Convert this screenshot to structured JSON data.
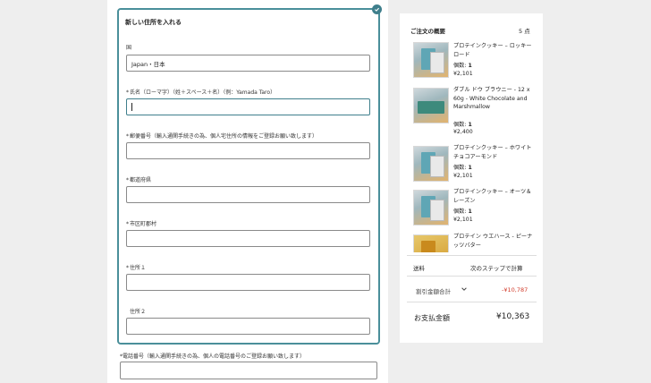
{
  "form": {
    "title": "新しい住所を入れる",
    "country_label": "国",
    "country_value": "Japan・日本",
    "name_label": "氏名（ローマ字）（姓＋スペース＋名）（例：Yamada Taro）",
    "zip_label": "郵便番号（輸入通関手続きの為、個人宅住所の情報をご登録お願い致します）",
    "prefecture_label": "都道府県",
    "city_label": "市区町郡村",
    "address1_label": "住所１",
    "address2_label": "住所２",
    "phone_label": "電話番号（輸入通関手続きの為、個人の電話番号のご登録お願い致します）",
    "required_mark": "*"
  },
  "summary": {
    "title": "ご注文の概要",
    "count": "5 点",
    "items": [
      {
        "name": "プロテインクッキー – ロッキーロード",
        "qty_label": "個数:",
        "qty": "1",
        "price": "¥2,101",
        "image": "protein-cookie-pack"
      },
      {
        "name": "ダブル ドウ ブラウニー - 12 x 60g - White Chocolate and Marshmallow",
        "qty_label": "個数:",
        "qty": "1",
        "price": "¥2,400",
        "image": "brownie-box"
      },
      {
        "name": "プロテインクッキー – ホワイトチョコアーモンド",
        "qty_label": "個数:",
        "qty": "1",
        "price": "¥2,101",
        "image": "protein-cookie-pack"
      },
      {
        "name": "プロテインクッキー – オーツ＆レーズン",
        "qty_label": "個数:",
        "qty": "1",
        "price": "¥2,101",
        "image": "protein-cookie-pack"
      },
      {
        "name": "プロテイン ウエハース - ピーナッツバター",
        "image": "wafer-box"
      }
    ],
    "shipping_label": "送料",
    "shipping_value": "次のステップで計算",
    "discount_label": "割引金額合計",
    "discount_value": "-¥10,787",
    "total_label": "お支払金額",
    "total_value": "¥10,363",
    "accent_color": "#3f7f8c",
    "discount_color": "#d23b2b"
  }
}
